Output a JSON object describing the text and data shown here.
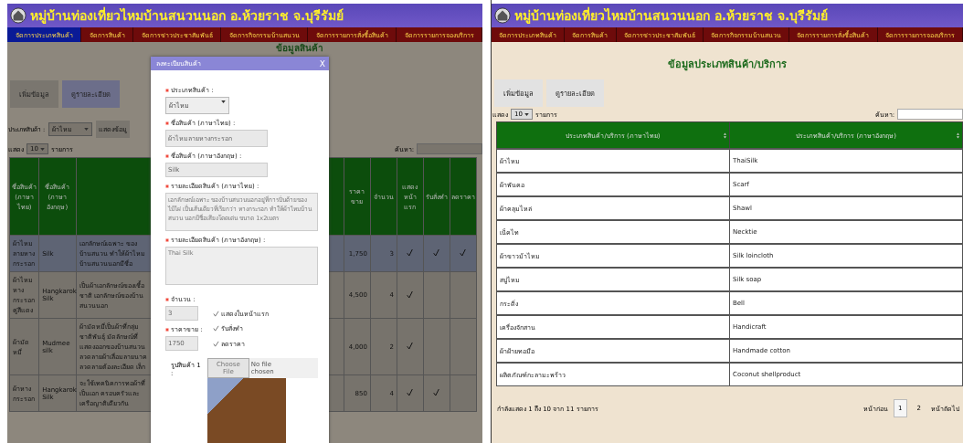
{
  "left_screen": {
    "site_title": "หมู่บ้านท่องเที่ยวไหมบ้านสนวนนอก อ.ห้วยราช จ.บุรีรัมย์",
    "nav": [
      {
        "label": "จัดการประเภทสินค้า",
        "selected": true
      },
      {
        "label": "จัดการสินค้า",
        "selected": false
      },
      {
        "label": "จัดการข่าวประชาสัมพันธ์",
        "selected": false
      },
      {
        "label": "จัดการกิจกรรมบ้านสนวน",
        "selected": false
      },
      {
        "label": "จัดการรายการสั่งซื้อสินค้า",
        "selected": false
      },
      {
        "label": "จัดการรายการจองบริการ",
        "selected": false
      }
    ],
    "page_title": "ข้อมูลสินค้า",
    "buttons": [
      {
        "label": "เพิ่มข้อมูล",
        "selected": false
      },
      {
        "label": "ดูรายละเอียด",
        "selected": true
      }
    ],
    "filter": {
      "label": "ประเภทสินค้า :",
      "value": "ผ้าไหม",
      "button": "แสดงข้อมู"
    },
    "length": {
      "prefix": "แสดง",
      "value": "10",
      "suffix": "รายการ"
    },
    "search_label": "ค้นหา:",
    "table": {
      "columns": [
        "ชื่อสินค้า (ภาษาไทย)",
        "ชื่อสินค้า (ภาษาอังกฤษ)",
        "ราคาขาย",
        "จำนวน",
        "แสดงหน้าแรก",
        "รับสั่งทำ",
        "ลดราคา"
      ],
      "rows": [
        {
          "name_th": "ผ้าไหมลายหางกระรอก",
          "name_en": "Silk",
          "description": "เอกลักษณ์เฉพาะ ของบ้านสนวน ทำให้ผ้าไหมบ้านสนวนนอกมีชื่อ",
          "price": "1,750",
          "quantity": "3",
          "show_on_home": true,
          "made_to_order": true,
          "discount": true,
          "selected": true
        },
        {
          "name_th": "ผ้าไหมหางกระรอกคู่สีแดง",
          "name_en": "Hangkarok Silk",
          "description": "เป็นผ้าเอกลักษณ์ของเชื้อชาติ เอกลักษณ์ของบ้านสนวนนอก",
          "price": "4,500",
          "quantity": "4",
          "show_on_home": true,
          "made_to_order": false,
          "discount": false,
          "selected": false
        },
        {
          "name_th": "ผ้ามัดหมี่",
          "name_en": "Mudmee silk",
          "description": "ผ้ามัดหมี่เป็นผ้าที่กลุ่มชาติพันธุ์ มัดลักษณ์ที่แสดงออกของบ้านสนวน ลวดลายผ้าเลื่อมลายนาค ลวดลายต้องละเอียด เล็ก",
          "price": "4,000",
          "quantity": "2",
          "show_on_home": true,
          "made_to_order": false,
          "discount": false,
          "selected": false
        },
        {
          "name_th": "ผ้าหางกระรอก",
          "name_en": "Hangkarok Silk",
          "description": "จะใช้เทคนิคการทอผ้าที่เป็นเอก ครอบครัวและเครือญาติเดียวกัน",
          "price": "850",
          "quantity": "4",
          "show_on_home": true,
          "made_to_order": true,
          "discount": false,
          "selected": false
        }
      ]
    }
  },
  "modal": {
    "title": "ลงทะเบียนสินค้า",
    "close": "X",
    "fields": [
      {
        "kind": "select",
        "label": "ประเภทสินค้า :",
        "required": true,
        "value": "ผ้าไหม"
      },
      {
        "kind": "text",
        "label": "ชื่อสินค้า (ภาษาไทย) :",
        "required": true,
        "value": "ผ้าไหมลายหางกระรอก"
      },
      {
        "kind": "text",
        "label": "ชื่อสินค้า (ภาษาอังกฤษ) :",
        "required": true,
        "value": "Silk"
      },
      {
        "kind": "textarea",
        "label": "รายละเอียดสินค้า (ภาษาไทย) :",
        "required": true,
        "value": "เอกลักษณ์เฉพาะ ของบ้านสนวนนอกอยู่ที่การปั่นด้ายของไม้ไผ่ เป็นเส้นเดียวที่เรียกว่า หางกระรอก ทำให้ผ้าไหมบ้านสนวน นอกมีชื่อเสียงโดดเด่น ขนาด 1x2เมตร"
      },
      {
        "kind": "textarea",
        "label": "รายละเอียดสินค้า (ภาษาอังกฤษ) :",
        "required": true,
        "value": "Thai Silk"
      }
    ],
    "quantity": {
      "label": "จำนวน :",
      "required": true,
      "value": "3"
    },
    "price": {
      "label": "ราคาขาย :",
      "required": true,
      "value": "1750"
    },
    "checkboxes": [
      {
        "label": "แสดงในหน้าแรก",
        "checked": true
      },
      {
        "label": "รับสั่งทำ",
        "checked": true
      },
      {
        "label": "ลดราคา",
        "checked": true
      }
    ],
    "image": {
      "label": "รูปสินค้า 1 :",
      "button": "Choose File",
      "status": "No file chosen"
    }
  },
  "right_screen": {
    "site_title": "หมู่บ้านท่องเที่ยวไหมบ้านสนวนนอก อ.ห้วยราช จ.บุรีรัมย์",
    "nav": [
      {
        "label": "จัดการประเภทสินค้า",
        "selected": false
      },
      {
        "label": "จัดการสินค้า",
        "selected": false
      },
      {
        "label": "จัดการข่าวประชาสัมพันธ์",
        "selected": false
      },
      {
        "label": "จัดการกิจกรรมบ้านสนวน",
        "selected": false
      },
      {
        "label": "จัดการรายการสั่งซื้อสินค้า",
        "selected": false
      },
      {
        "label": "จัดการรายการจองบริการ",
        "selected": false
      }
    ],
    "page_title": "ข้อมูลประเภทสินค้า/บริการ",
    "buttons": [
      {
        "label": "เพิ่มข้อมูล",
        "selected": false
      },
      {
        "label": "ดูรายละเอียด",
        "selected": false
      }
    ],
    "length": {
      "prefix": "แสดง",
      "value": "10",
      "suffix": "รายการ"
    },
    "search_label": "ค้นหา:",
    "table": {
      "columns": [
        "ประเภทสินค้า/บริการ (ภาษาไทย)",
        "ประเภทสินค้า/บริการ (ภาษาอังกฤษ)"
      ],
      "rows": [
        {
          "name_th": "ผ้าไหม",
          "name_en": "ThaiSilk"
        },
        {
          "name_th": "ผ้าพันคอ",
          "name_en": "Scarf"
        },
        {
          "name_th": "ผ้าคลุมไหล่",
          "name_en": "Shawl"
        },
        {
          "name_th": "เน็คไท",
          "name_en": "Necktie"
        },
        {
          "name_th": "ผ้าขาวม้าไหม",
          "name_en": "Silk loincloth"
        },
        {
          "name_th": "สบู่ไหม",
          "name_en": "Silk soap"
        },
        {
          "name_th": "กระดิ่ง",
          "name_en": "Bell"
        },
        {
          "name_th": "เครื่องจักสาน",
          "name_en": "Handicraft"
        },
        {
          "name_th": "ผ้าฝ้ายทอมือ",
          "name_en": "Handmade cotton"
        },
        {
          "name_th": "ผลิตภัณฑ์กะลามะพร้าว",
          "name_en": "Coconut shellproduct"
        }
      ]
    },
    "info": "กำลังแสดง 1 ถึง 10 จาก 11 รายการ",
    "pager": {
      "previous": "หน้าก่อน",
      "pages": [
        {
          "label": "1",
          "selected": true
        },
        {
          "label": "2",
          "selected": false
        }
      ],
      "next": "หน้าถัดไป"
    }
  }
}
